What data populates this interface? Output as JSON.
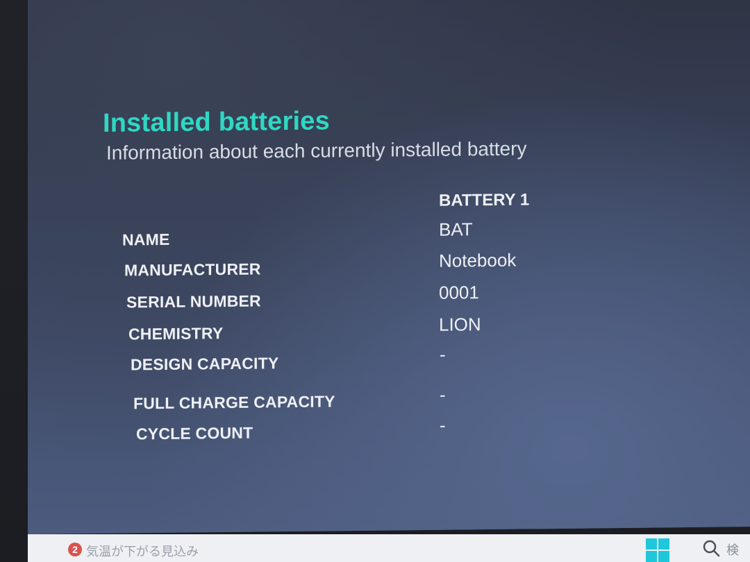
{
  "report": {
    "title": "Installed batteries",
    "subtitle": "Information about each currently installed battery",
    "column_header": "BATTERY 1",
    "rows": [
      {
        "label": "NAME",
        "value": "BAT"
      },
      {
        "label": "MANUFACTURER",
        "value": "Notebook"
      },
      {
        "label": "SERIAL NUMBER",
        "value": "0001"
      },
      {
        "label": "CHEMISTRY",
        "value": "LION"
      },
      {
        "label": "DESIGN CAPACITY",
        "value": "-"
      },
      {
        "label": "FULL CHARGE CAPACITY",
        "value": "-"
      },
      {
        "label": "CYCLE COUNT",
        "value": "-"
      }
    ]
  },
  "taskbar": {
    "notification_count": "2",
    "weather_text": "気温が下がる見込み",
    "search_text": "検"
  },
  "colors": {
    "title": "#2fd8c3",
    "windows_logo": "#1ec7d9",
    "badge": "#d9534f"
  },
  "icons": [
    "windows-start-icon",
    "search-icon"
  ]
}
